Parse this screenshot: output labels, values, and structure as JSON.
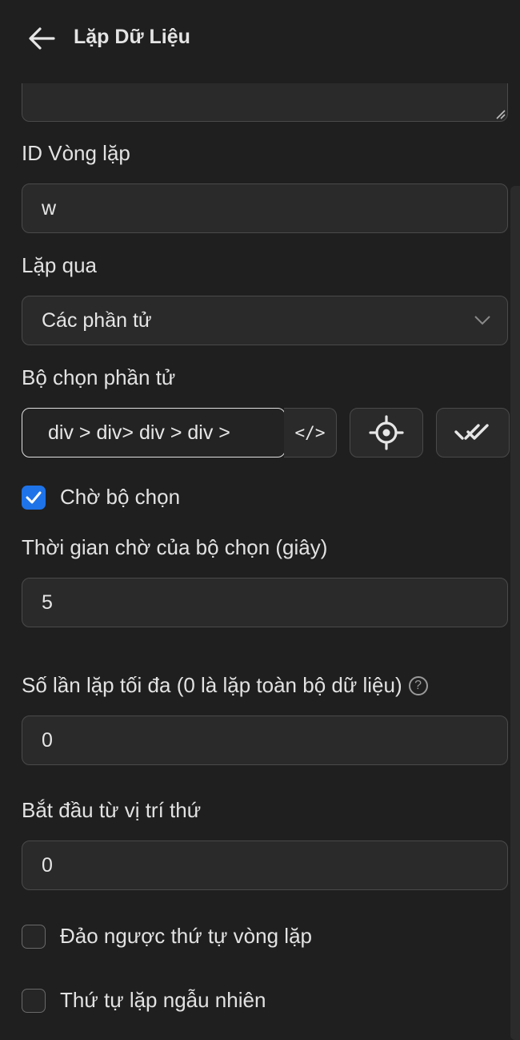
{
  "header": {
    "title": "Lặp Dữ Liệu"
  },
  "form": {
    "loop_id": {
      "label": "ID Vòng lặp",
      "value": "w"
    },
    "loop_over": {
      "label": "Lặp qua",
      "value": "Các phần tử"
    },
    "element_selector": {
      "label": "Bộ chọn phần tử",
      "value": "div > div> div > div >",
      "code_label": "</>"
    },
    "wait_selector": {
      "label": "Chờ bộ chọn",
      "checked": true
    },
    "selector_timeout": {
      "label": "Thời gian chờ của bộ chọn (giây)",
      "value": "5"
    },
    "max_iterations": {
      "label": "Số lần lặp tối đa (0 là lặp toàn bộ dữ liệu)",
      "value": "0",
      "help": "?"
    },
    "start_index": {
      "label": "Bắt đầu từ vị trí thứ",
      "value": "0"
    },
    "reverse_order": {
      "label": "Đảo ngược thứ tự vòng lặp",
      "checked": false
    },
    "random_order": {
      "label": "Thứ tự lặp ngẫu nhiên",
      "checked": false
    }
  },
  "colors": {
    "background": "#1f1f1f",
    "input": "#2a2a2a",
    "accent": "#1e73e8"
  },
  "icons": {
    "back": "arrow-left-icon",
    "target": "crosshair-icon",
    "check_all": "double-check-icon",
    "dropdown": "chevron-down-icon"
  }
}
